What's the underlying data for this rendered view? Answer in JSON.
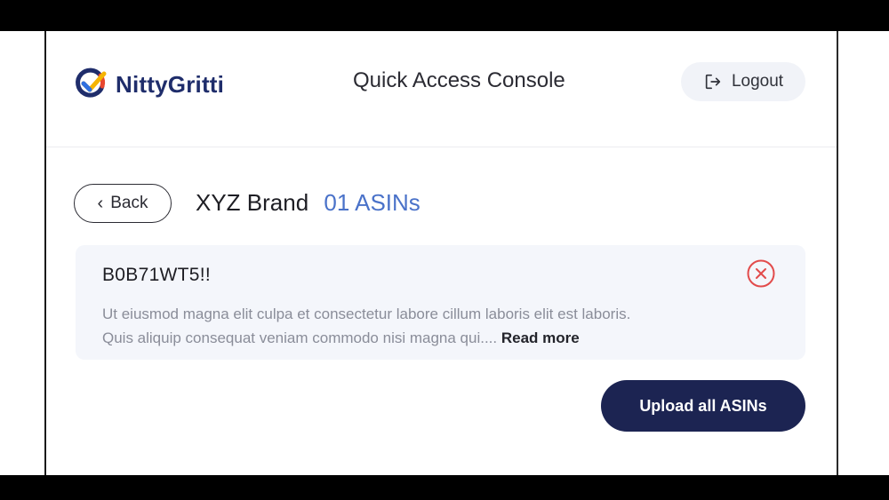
{
  "header": {
    "brand": "NittyGritti",
    "console_title": "Quick Access Console",
    "logout_label": "Logout"
  },
  "page": {
    "back_label": "Back",
    "brand_name": "XYZ Brand",
    "asin_count": "01 ASINs"
  },
  "alert": {
    "title": "B0B71WT5!!",
    "body_line1": "Ut eiusmod magna elit culpa et consectetur labore cillum laboris elit est laboris.",
    "body_line2": "Quis aliquip consequat veniam commodo nisi magna qui....",
    "read_more": "Read more",
    "close_icon": "close-circle-icon"
  },
  "actions": {
    "upload_label": "Upload all ASINs"
  },
  "colors": {
    "brand_navy": "#1f2d6b",
    "accent_blue": "#4a72c9",
    "button_dark": "#1c2452",
    "close_red": "#e24b4b",
    "card_bg": "#f4f6fb"
  }
}
